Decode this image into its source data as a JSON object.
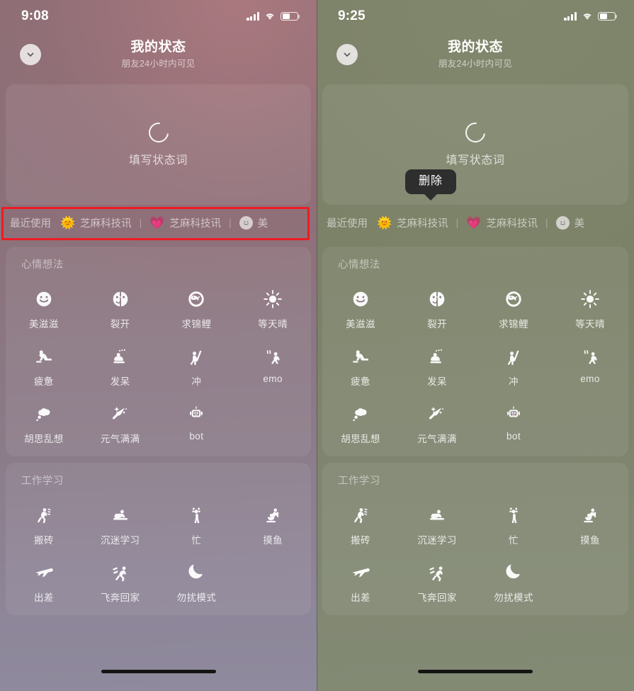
{
  "panels": [
    {
      "key": "left",
      "statusbar": {
        "time": "9:08",
        "signal_icon": "signal-bars-icon",
        "wifi_icon": "wifi-icon",
        "battery_icon": "battery-icon",
        "battery_level": "50%"
      },
      "nav": {
        "back_icon": "chevron-down-icon",
        "title": "我的状态",
        "subtitle": "朋友24小时内可见"
      },
      "composer": {
        "ring_icon": "status-ring-icon",
        "label": "填写状态词"
      },
      "recent": {
        "label": "最近使用",
        "separator": "|",
        "items": [
          {
            "emoji": "🌞",
            "icon_name": "sun-emoji-icon",
            "text": "芝麻科技讯"
          },
          {
            "emoji": "💗",
            "icon_name": "heart-emoji-icon",
            "text": "芝麻科技讯"
          },
          {
            "emoji": "",
            "icon_name": "smiley-face-icon",
            "text": "美"
          }
        ]
      },
      "highlight_box": {
        "visible": true,
        "color": "#ee1b24"
      },
      "tooltip": {
        "visible": false,
        "label": "删除"
      },
      "sections": [
        {
          "title": "心情想法",
          "items": [
            {
              "label": "美滋滋",
              "icon": "smiley-face-icon"
            },
            {
              "label": "裂开",
              "icon": "cracked-face-icon"
            },
            {
              "label": "求锦鲤",
              "icon": "koi-fish-icon"
            },
            {
              "label": "等天晴",
              "icon": "sun-icon"
            },
            {
              "label": "疲惫",
              "icon": "tired-person-icon"
            },
            {
              "label": "发呆",
              "icon": "daze-person-icon"
            },
            {
              "label": "冲",
              "icon": "charging-person-icon"
            },
            {
              "label": "emo",
              "icon": "emo-person-icon"
            },
            {
              "label": "胡思乱想",
              "icon": "thought-cloud-icon"
            },
            {
              "label": "元气满满",
              "icon": "sparkle-star-icon"
            },
            {
              "label": "bot",
              "icon": "robot-icon"
            }
          ]
        },
        {
          "title": "工作学习",
          "items": [
            {
              "label": "搬砖",
              "icon": "carrying-bricks-icon"
            },
            {
              "label": "沉迷学习",
              "icon": "studying-desk-icon"
            },
            {
              "label": "忙",
              "icon": "busy-person-icon"
            },
            {
              "label": "摸鱼",
              "icon": "slacking-toilet-icon"
            },
            {
              "label": "出差",
              "icon": "airplane-icon"
            },
            {
              "label": "飞奔回家",
              "icon": "running-home-icon"
            },
            {
              "label": "勿扰模式",
              "icon": "crescent-moon-icon"
            }
          ]
        }
      ]
    },
    {
      "key": "right",
      "statusbar": {
        "time": "9:25",
        "signal_icon": "signal-bars-icon",
        "wifi_icon": "wifi-icon",
        "battery_icon": "battery-icon",
        "battery_level": "50%"
      },
      "nav": {
        "back_icon": "chevron-down-icon",
        "title": "我的状态",
        "subtitle": "朋友24小时内可见"
      },
      "composer": {
        "ring_icon": "status-ring-icon",
        "label": "填写状态词"
      },
      "recent": {
        "label": "最近使用",
        "separator": "|",
        "items": [
          {
            "emoji": "🌞",
            "icon_name": "sun-emoji-icon",
            "text": "芝麻科技讯"
          },
          {
            "emoji": "💗",
            "icon_name": "heart-emoji-icon",
            "text": "芝麻科技讯"
          },
          {
            "emoji": "",
            "icon_name": "smiley-face-icon",
            "text": "美"
          }
        ]
      },
      "highlight_box": {
        "visible": false,
        "color": "#ee1b24"
      },
      "tooltip": {
        "visible": true,
        "label": "删除"
      },
      "sections": [
        {
          "title": "心情想法",
          "items": [
            {
              "label": "美滋滋",
              "icon": "smiley-face-icon"
            },
            {
              "label": "裂开",
              "icon": "cracked-face-icon"
            },
            {
              "label": "求锦鲤",
              "icon": "koi-fish-icon"
            },
            {
              "label": "等天晴",
              "icon": "sun-icon"
            },
            {
              "label": "疲惫",
              "icon": "tired-person-icon"
            },
            {
              "label": "发呆",
              "icon": "daze-person-icon"
            },
            {
              "label": "冲",
              "icon": "charging-person-icon"
            },
            {
              "label": "emo",
              "icon": "emo-person-icon"
            },
            {
              "label": "胡思乱想",
              "icon": "thought-cloud-icon"
            },
            {
              "label": "元气满满",
              "icon": "sparkle-star-icon"
            },
            {
              "label": "bot",
              "icon": "robot-icon"
            }
          ]
        },
        {
          "title": "工作学习",
          "items": [
            {
              "label": "搬砖",
              "icon": "carrying-bricks-icon"
            },
            {
              "label": "沉迷学习",
              "icon": "studying-desk-icon"
            },
            {
              "label": "忙",
              "icon": "busy-person-icon"
            },
            {
              "label": "摸鱼",
              "icon": "slacking-toilet-icon"
            },
            {
              "label": "出差",
              "icon": "airplane-icon"
            },
            {
              "label": "飞奔回家",
              "icon": "running-home-icon"
            },
            {
              "label": "勿扰模式",
              "icon": "crescent-moon-icon"
            }
          ]
        }
      ]
    }
  ],
  "theme": {
    "left_bg_top": "#8c6f76",
    "left_bg_bottom": "#8f8a9e",
    "right_bg_top": "#7d8268",
    "right_bg_bottom": "#838a74",
    "highlight": "#ee1b24",
    "tooltip_bg": "#2e2e2e"
  }
}
